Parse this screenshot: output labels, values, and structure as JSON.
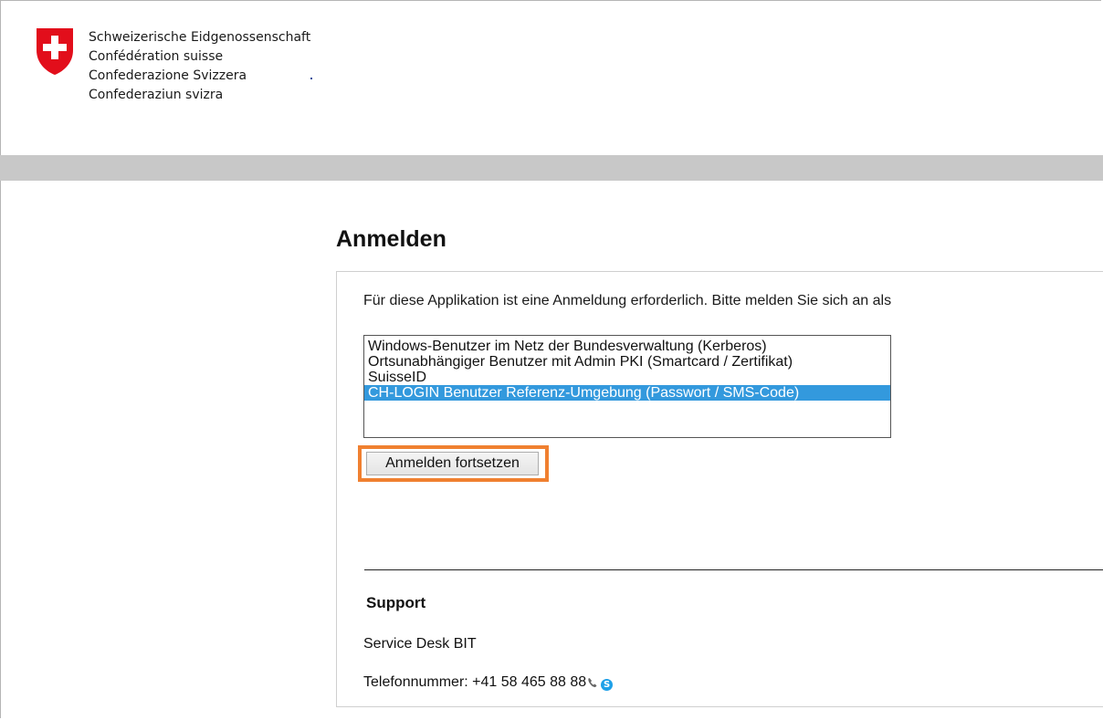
{
  "header": {
    "confederation_names": [
      "Schweizerische Eidgenossenschaft",
      "Confédération suisse",
      "Confederazione Svizzera",
      "Confederaziun svizra"
    ],
    "crest_colors": {
      "shield": "#e20e1b",
      "cross": "#ffffff"
    }
  },
  "main": {
    "title": "Anmelden",
    "intro_text": "Für diese Applikation ist eine Anmeldung erforderlich. Bitte melden Sie sich an als",
    "login_options": [
      "Windows-Benutzer im Netz der Bundesverwaltung (Kerberos)",
      "Ortsunabhängiger Benutzer mit Admin PKI (Smartcard / Zertifikat)",
      "SuisseID",
      "CH-LOGIN Benutzer Referenz-Umgebung (Passwort / SMS-Code)"
    ],
    "selected_option": "CH-LOGIN Benutzer Referenz-Umgebung (Passwort / SMS-Code)",
    "continue_button": "Anmelden fortsetzen",
    "highlight_color": "#f08030",
    "selection_color": "#3399dd"
  },
  "support": {
    "heading": "Support",
    "service_desk": "Service Desk BIT",
    "phone_text": "Telefonnummer: +41 58 465 88 88"
  }
}
